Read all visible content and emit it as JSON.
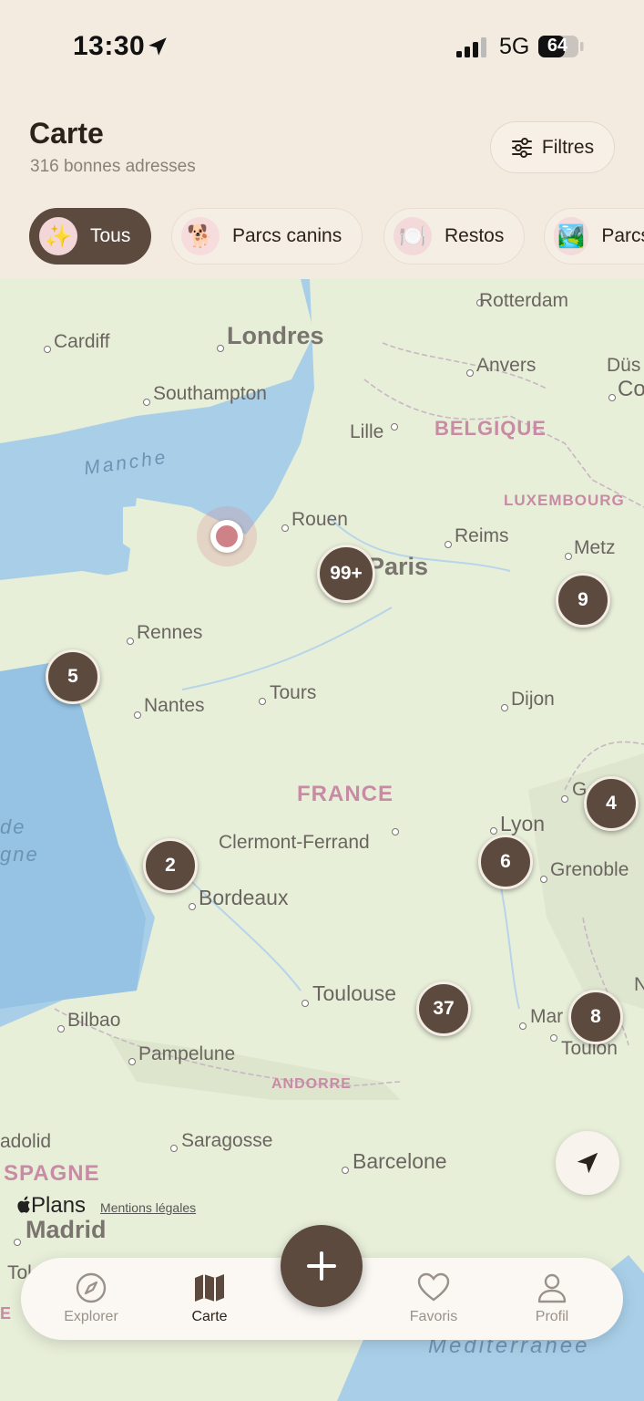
{
  "status_bar": {
    "time": "13:30",
    "network": "5G",
    "battery": "64"
  },
  "header": {
    "title": "Carte",
    "subtitle": "316 bonnes adresses",
    "filters_label": "Filtres"
  },
  "chips": [
    {
      "label": "Tous",
      "icon": "sparkles-icon",
      "emoji": "✨",
      "active": true
    },
    {
      "label": "Parcs canins",
      "icon": "dog-icon",
      "emoji": "🐕",
      "active": false
    },
    {
      "label": "Restos",
      "icon": "plate-icon",
      "emoji": "🍽️",
      "active": false
    },
    {
      "label": "Parcs",
      "icon": "landscape-icon",
      "emoji": "🏞️",
      "active": false
    }
  ],
  "map": {
    "cities": {
      "rotterdam": "Rotterdam",
      "cardiff": "Cardiff",
      "londres": "Londres",
      "anvers": "Anvers",
      "dusseldorf": "Düs",
      "cologne": "Co",
      "southampton": "Southampton",
      "lille": "Lille",
      "rouen": "Rouen",
      "reims": "Reims",
      "metz": "Metz",
      "paris": "Paris",
      "rennes": "Rennes",
      "tours": "Tours",
      "nantes": "Nantes",
      "dijon": "Dijon",
      "clermont": "Clermont-Ferrand",
      "lyon": "Lyon",
      "grenoble": "Grenoble",
      "bordeaux": "Bordeaux",
      "toulouse": "Toulouse",
      "bilbao": "Bilbao",
      "pampelune": "Pampelune",
      "marseille": "Mar",
      "toulon": "Toulon",
      "valladolid": "adolid",
      "saragosse": "Saragosse",
      "barcelone": "Barcelone",
      "madrid": "Madrid",
      "tol": "Tol",
      "geneve": "G",
      "nice": "N"
    },
    "countries": {
      "belgique": "BELGIQUE",
      "luxembourg": "LUXEMBOURG",
      "france": "FRANCE",
      "andorre": "ANDORRE",
      "espagne": "SPAGNE",
      "espagne2": "E"
    },
    "seas": {
      "manche": "Manche",
      "golfe1": "de",
      "golfe2": "gne",
      "mediterranee": "Méditerranée"
    },
    "clusters": [
      {
        "id": "paris",
        "count": "99+"
      },
      {
        "id": "metz",
        "count": "9"
      },
      {
        "id": "brittany",
        "count": "5"
      },
      {
        "id": "geneva",
        "count": "4"
      },
      {
        "id": "bordeaux",
        "count": "2"
      },
      {
        "id": "lyon",
        "count": "6"
      },
      {
        "id": "montpellier",
        "count": "37"
      },
      {
        "id": "toulon",
        "count": "8"
      }
    ],
    "attribution": "Plans",
    "legal": "Mentions légales"
  },
  "tabs": [
    {
      "label": "Explorer",
      "icon": "compass-icon",
      "active": false
    },
    {
      "label": "Carte",
      "icon": "map-icon",
      "active": true
    },
    {
      "label": "Favoris",
      "icon": "heart-icon",
      "active": false
    },
    {
      "label": "Profil",
      "icon": "person-icon",
      "active": false
    }
  ],
  "colors": {
    "accent": "#5c4a3e",
    "background": "#f3ebe0",
    "pin": "#cf8188",
    "land": "#e8efd9",
    "sea": "#a9cfe8"
  }
}
